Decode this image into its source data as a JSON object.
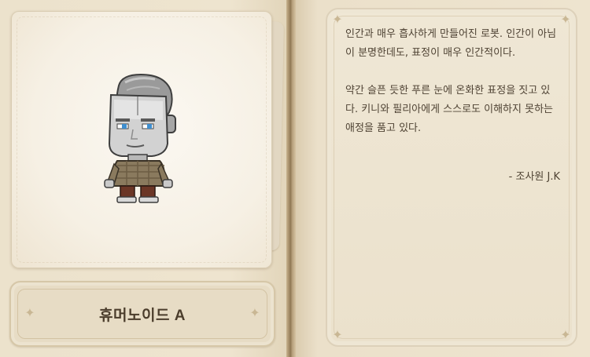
{
  "entry": {
    "name": "휴머노이드 A",
    "portrait_icon": "humanoid-robot-sprite"
  },
  "description": {
    "paragraphs": [
      "인간과 매우 흡사하게 만들어진 로봇. 인간이 아님이 분명한데도, 표정이 매우 인간적이다.",
      "약간 슬픈 듯한 푸른 눈에 온화한 표정을 짓고 있다. 키니와 필리아에게 스스로도 이해하지 못하는 애정을 품고 있다."
    ],
    "signature": "- 조사원 J.K"
  },
  "colors": {
    "paper": "#eee4cf",
    "text": "#4f4334",
    "frame": "#ddd1ba"
  }
}
